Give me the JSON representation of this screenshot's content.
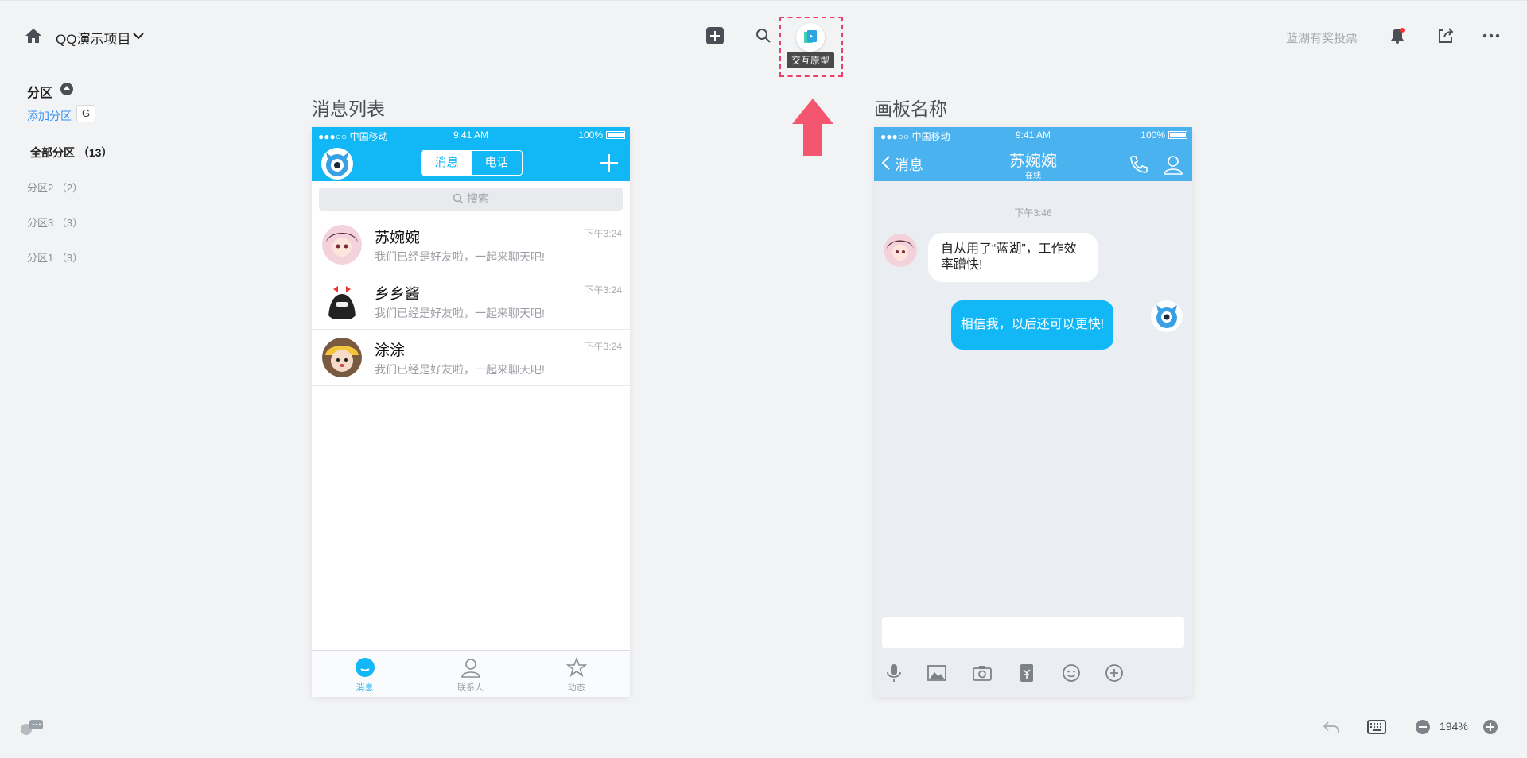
{
  "topbar": {
    "project_name": "QQ演示项目",
    "prototype_tooltip": "交互原型",
    "vote_link": "蓝湖有奖投票"
  },
  "sidebar": {
    "title": "分区",
    "add_section": "添加分区",
    "shortcut_key": "G",
    "sections": [
      {
        "label": "全部分区",
        "count": "（13）"
      },
      {
        "label": "分区2",
        "count": "（2）"
      },
      {
        "label": "分区3",
        "count": "（3）"
      },
      {
        "label": "分区1",
        "count": "（3）"
      }
    ]
  },
  "artboards": [
    {
      "label": "消息列表"
    },
    {
      "label": "画板名称"
    }
  ],
  "status_bar": {
    "carrier": "●●●○○ 中国移动",
    "time": "9:41 AM",
    "battery": "100%"
  },
  "message_list": {
    "seg_messages": "消息",
    "seg_calls": "电话",
    "search_placeholder": "搜索",
    "chats": [
      {
        "name": "苏婉婉",
        "preview": "我们已经是好友啦，一起来聊天吧!",
        "time": "下午3:24"
      },
      {
        "name": "乡乡酱",
        "preview": "我们已经是好友啦，一起来聊天吧!",
        "time": "下午3:24"
      },
      {
        "name": "涂涂",
        "preview": "我们已经是好友啦，一起来聊天吧!",
        "time": "下午3:24"
      }
    ],
    "tabs": [
      "消息",
      "联系人",
      "动态"
    ]
  },
  "chat_detail": {
    "back_label": "消息",
    "contact_name": "苏婉婉",
    "contact_status": "在线",
    "timestamp": "下午3:46",
    "incoming_message": "自从用了“蓝湖”，工作效率蹭快!",
    "outgoing_message": "相信我，以后还可以更快!"
  },
  "footer": {
    "zoom": "194%"
  },
  "colors": {
    "accent": "#12b7f5",
    "chat_header": "#4ab3ef",
    "highlight": "#e8416a",
    "link": "#2f8ef6"
  }
}
